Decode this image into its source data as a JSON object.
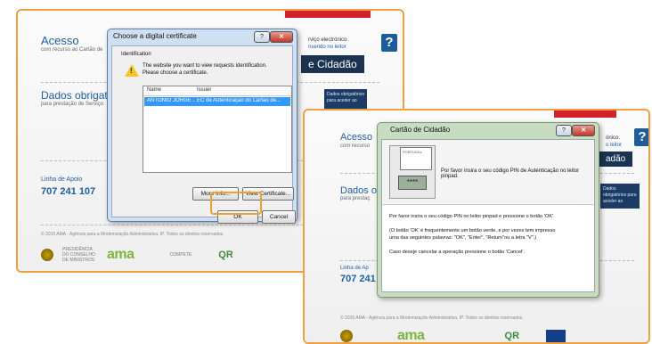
{
  "background_page_1": {
    "acesso_title": "Acesso",
    "acesso_sub": "com recurso ao Cartão de",
    "right_text_1": "rviço electrónico.",
    "right_text_2": "nserido no leitor",
    "cidadao_button": "e Cidadão",
    "dados_title": "Dados obrigatc",
    "dados_sub": "para prestação de Serviço",
    "side_note": "Dados obrigatórios para aceder ao",
    "help_glyph": "?",
    "linha_label": "Linha de Apoio",
    "phone": "707 241 107",
    "footer_text": "© 2015 AMA - Agência para a Modernização Administrativa, IP. Todos os direitos reservados.",
    "logo_ama": "ama",
    "logo_compete": "COMPETE",
    "logo_qr": "QR",
    "logo_seal_caption": "PRESIDÊNCIA DO CONSELHO DE MINISTROS"
  },
  "dialog_certificate": {
    "title": "Choose a digital certificate",
    "help_glyph": "?",
    "close_glyph": "✕",
    "group_label": "Identification",
    "message": "The website you want to view requests identification. Please choose a certificate.",
    "columns": [
      "Name",
      "Issuer"
    ],
    "rows": [
      {
        "name": "ANTÓNIO JORGE ...",
        "issuer": "EC de Autenticação do Cartão de..."
      }
    ],
    "more_info_label": "More Info...",
    "view_cert_label": "View Certificate...",
    "ok_label": "OK",
    "cancel_label": "Cancel"
  },
  "background_page_2": {
    "acesso_title": "Acesso",
    "acesso_sub": "com recurso",
    "right_text_1": "ónico.",
    "right_text_2": "o leitor",
    "cidadao_button": "adão",
    "dados_title": "Dados ob",
    "dados_sub": "para prestaç",
    "side_note": "Dados obrigatórios para aceder ao",
    "help_glyph": "?",
    "linha_label": "Linha de Ap",
    "phone": "707 241",
    "footer_text": "© 2015 AMA - Agência para a Modernização Administrativa, IP. Todos os direitos reservados.",
    "logo_ama": "ama",
    "logo_qr": "QR"
  },
  "dialog_pin": {
    "title": "Cartão de Cidadão",
    "help_glyph": "?",
    "close_glyph": "✕",
    "card_label": "PORTUGAL",
    "keypad_label": "****",
    "card_message": "Por favor insira o seu código PIN de Autenticação no leitor pinpad.",
    "line1": "Por favor insira o seu código PIN no leitor pinpad e pressione o botão 'OK'.",
    "line2": "(O botão 'OK' é frequentemente um botão verde, e por vezes tem impresso",
    "line3": "uma das seguintes palavras: \"OK\", \"Enter\", \"Return\"ou a letra \"V\".)",
    "line4": "Caso deseje cancelar a operação pressione o botão 'Cancel'."
  },
  "colors": {
    "highlight": "#f0a040",
    "brand_blue": "#1b5fa8",
    "selection": "#3399ff",
    "red_tab": "#d4202a"
  }
}
